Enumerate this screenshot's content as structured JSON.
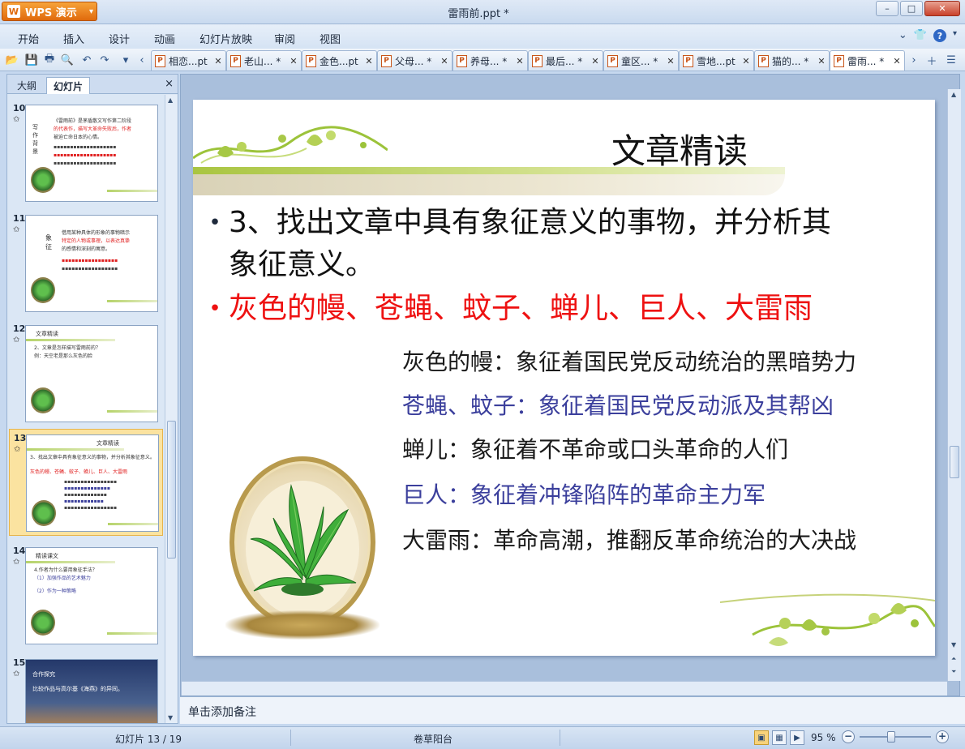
{
  "app": {
    "brand": "WPS 演示",
    "window_title": "雷雨前.ppt *",
    "window_controls": {
      "minimize": "–",
      "maximize": "□",
      "close": "✕"
    }
  },
  "menu": {
    "items": [
      "开始",
      "插入",
      "设计",
      "动画",
      "幻灯片放映",
      "审阅",
      "视图"
    ]
  },
  "doc_tabs": [
    {
      "label": "相恋...pt",
      "active": false
    },
    {
      "label": "老山... *",
      "active": false
    },
    {
      "label": "金色...pt",
      "active": false
    },
    {
      "label": "父母... *",
      "active": false
    },
    {
      "label": "养母... *",
      "active": false
    },
    {
      "label": "最后... *",
      "active": false
    },
    {
      "label": "童区... *",
      "active": false
    },
    {
      "label": "雪地...pt",
      "active": false
    },
    {
      "label": "猫的... *",
      "active": false
    },
    {
      "label": "雷雨... *",
      "active": true
    }
  ],
  "panel": {
    "tab_outline": "大纲",
    "tab_slides": "幻灯片",
    "close": "×"
  },
  "thumbnails": [
    {
      "num": "10",
      "selected": false,
      "lines": [
        "《雷雨前》是茅盾散文写作第二阶段",
        "的代表作，描写大革命失败后，作者",
        "被迫亡命日本的心情。 "
      ],
      "side": "写作背景"
    },
    {
      "num": "11",
      "selected": false,
      "lines": [
        "借用某种具体的形象的事物暗示",
        "特定的人物或事理，以表达真挚",
        "的感情和深刻的寓意。"
      ],
      "side": "象征"
    },
    {
      "num": "12",
      "selected": false,
      "title": "文章精读",
      "lines": [
        "2、文章是怎样描写雷雨前的？",
        "例：天空老是那么灰色的脸"
      ]
    },
    {
      "num": "13",
      "selected": true,
      "title": "文章精读",
      "lines": [
        "3、找出文章中具有象征意义的事物，并分析其象征意义。",
        "灰色的幔、苍蝇、蚊子、蝉儿、巨人、大雷雨"
      ]
    },
    {
      "num": "14",
      "selected": false,
      "title": "精读课文",
      "lines": [
        "4.作者为什么要用象征手法？",
        "（1）加强作品的艺术魅力",
        "（2）作为一种策略"
      ]
    },
    {
      "num": "15",
      "selected": false,
      "title": "合作探究",
      "lines": [
        "比较作品与高尔基《海燕》的异同。"
      ]
    }
  ],
  "slide": {
    "title": "文章精读",
    "question": "3、找出文章中具有象征意义的事物，并分析其象征意义。",
    "question_line1": "3、找出文章中具有象征意义的事物，并分析其",
    "question_line2": "象征意义。",
    "answer": "灰色的幔、苍蝇、蚊子、蝉儿、巨人、大雷雨",
    "symbols": [
      {
        "text": "灰色的幔：象征着国民党反动统治的黑暗势力",
        "color": "#1a1a1a"
      },
      {
        "text": "苍蝇、蚊子：象征着国民党反动派及其帮凶",
        "color": "#3b3f9c"
      },
      {
        "text": "蝉儿：象征着不革命或口头革命的人们",
        "color": "#1a1a1a"
      },
      {
        "text": "巨人：象征着冲锋陷阵的革命主力军",
        "color": "#3b3f9c"
      },
      {
        "text": "大雷雨：革命高潮，推翻反革命统治的大决战",
        "color": "#1a1a1a"
      }
    ],
    "answer_color": "#ee1111"
  },
  "notes_placeholder": "单击添加备注",
  "status": {
    "slide_counter": "幻灯片 13 / 19",
    "theme_name": "卷草阳台",
    "zoom": "95 %"
  },
  "colors": {
    "accent": "#e06a0c",
    "selection": "#fbe3a0"
  }
}
